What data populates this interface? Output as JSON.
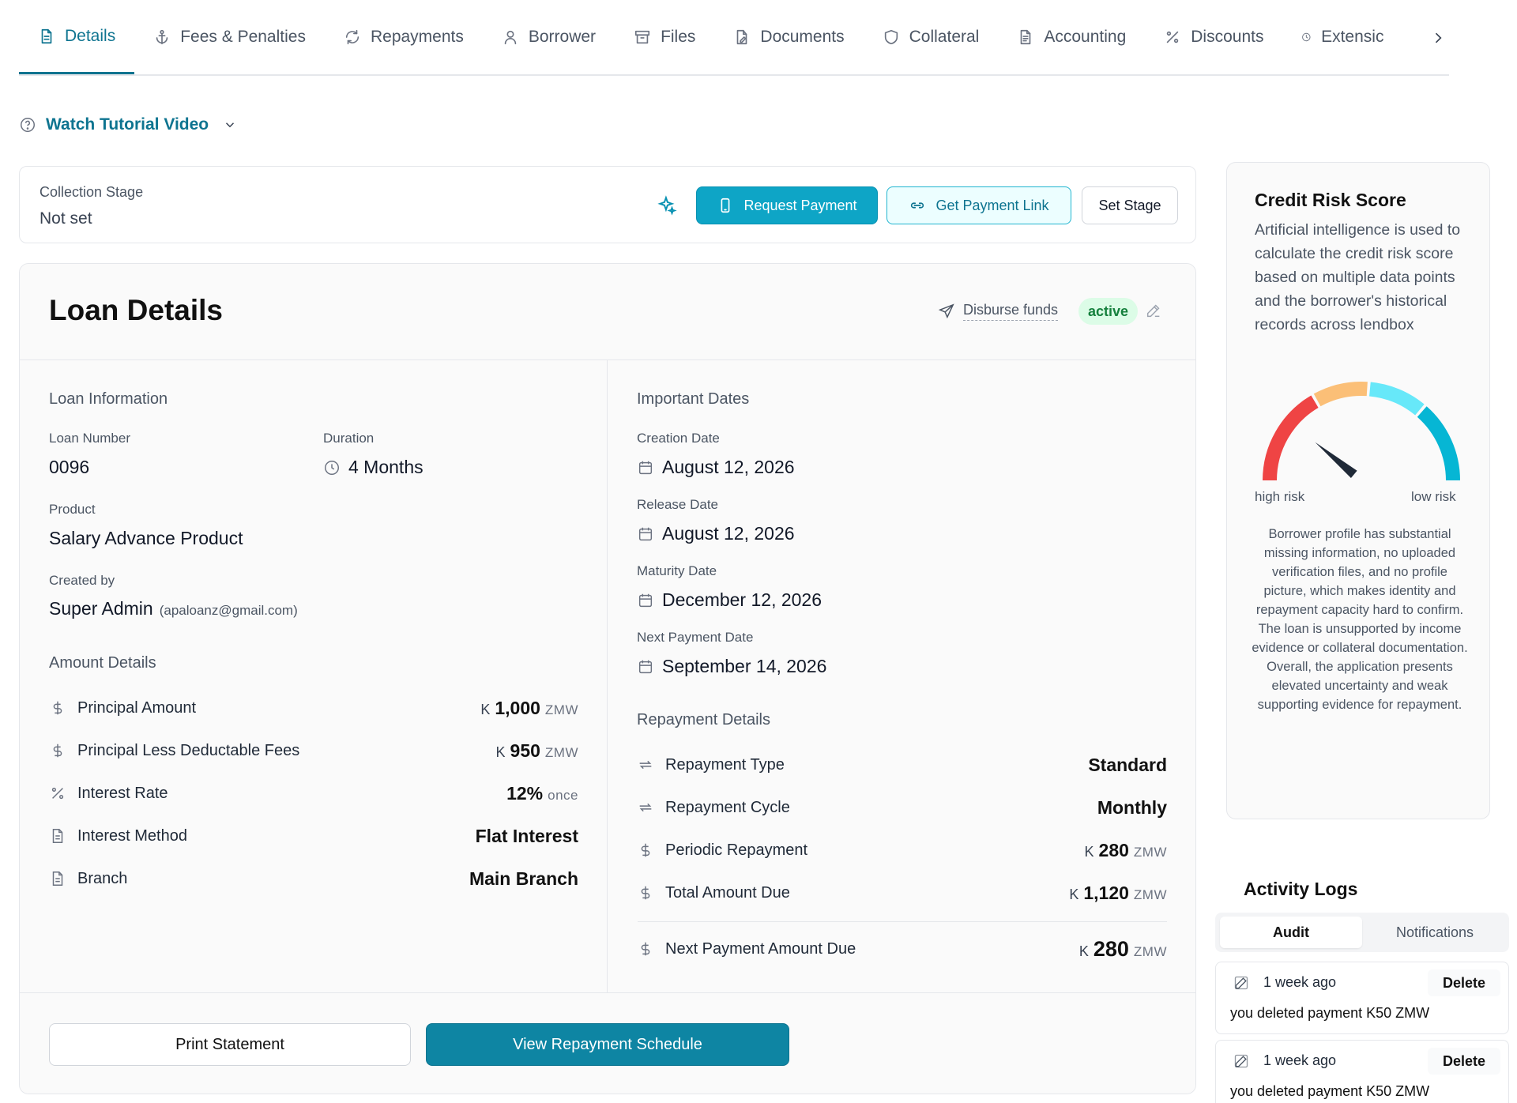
{
  "tabs": [
    {
      "label": "Details",
      "icon": "document-icon",
      "active": true
    },
    {
      "label": "Fees & Penalties",
      "icon": "anchor-icon"
    },
    {
      "label": "Repayments",
      "icon": "refresh-icon"
    },
    {
      "label": "Borrower",
      "icon": "user-icon"
    },
    {
      "label": "Files",
      "icon": "archive-icon"
    },
    {
      "label": "Documents",
      "icon": "document-edit-icon"
    },
    {
      "label": "Collateral",
      "icon": "shield-icon"
    },
    {
      "label": "Accounting",
      "icon": "ledger-icon"
    },
    {
      "label": "Discounts",
      "icon": "percent-icon"
    },
    {
      "label": "Extensic",
      "icon": "clock-icon"
    }
  ],
  "tutorial": {
    "label": "Watch Tutorial Video"
  },
  "collection": {
    "label": "Collection Stage",
    "value": "Not set",
    "request_payment": "Request Payment",
    "get_payment_link": "Get Payment Link",
    "set_stage": "Set Stage"
  },
  "loan": {
    "title": "Loan Details",
    "disburse": "Disburse funds",
    "status": "active",
    "info_title": "Loan Information",
    "loan_number_label": "Loan Number",
    "loan_number": "0096",
    "duration_label": "Duration",
    "duration": "4 Months",
    "product_label": "Product",
    "product": "Salary Advance Product",
    "created_by_label": "Created by",
    "created_by": "Super Admin",
    "created_by_email": "(apaloanz@gmail.com)",
    "amount_title": "Amount Details",
    "amounts": [
      {
        "label": "Principal Amount",
        "prefix": "K",
        "value": "1,000",
        "suffix": "ZMW"
      },
      {
        "label": "Principal Less Deductable Fees",
        "prefix": "K",
        "value": "950",
        "suffix": "ZMW"
      },
      {
        "label": "Interest Rate",
        "prefix": "",
        "value": "12%",
        "suffix": "once"
      },
      {
        "label": "Interest Method",
        "prefix": "",
        "value": "Flat Interest",
        "suffix": ""
      },
      {
        "label": "Branch",
        "prefix": "",
        "value": "Main Branch",
        "suffix": ""
      }
    ],
    "dates_title": "Important Dates",
    "dates": [
      {
        "label": "Creation Date",
        "value": "August 12, 2026"
      },
      {
        "label": "Release Date",
        "value": "August 12, 2026"
      },
      {
        "label": "Maturity Date",
        "value": "December 12, 2026"
      },
      {
        "label": "Next Payment Date",
        "value": "September 14, 2026"
      }
    ],
    "repayment_title": "Repayment Details",
    "repayments": [
      {
        "label": "Repayment Type",
        "prefix": "",
        "value": "Standard",
        "suffix": ""
      },
      {
        "label": "Repayment Cycle",
        "prefix": "",
        "value": "Monthly",
        "suffix": ""
      },
      {
        "label": "Periodic Repayment",
        "prefix": "K",
        "value": "280",
        "suffix": "ZMW"
      },
      {
        "label": "Total Amount Due",
        "prefix": "K",
        "value": "1,120",
        "suffix": "ZMW"
      }
    ],
    "next_due": {
      "label": "Next Payment Amount Due",
      "prefix": "K",
      "value": "280",
      "suffix": "ZMW"
    },
    "print_statement": "Print Statement",
    "view_schedule": "View Repayment Schedule"
  },
  "risk": {
    "title": "Credit Risk Score",
    "description": "Artificial intelligence is used to calculate the credit risk score based on multiple data points and the borrower's historical records across lendbox",
    "high_label": "high risk",
    "low_label": "low risk",
    "score_fraction": 0.22,
    "summary": "Borrower profile has substantial missing information, no uploaded verification files, and no profile picture, which makes identity and repayment capacity hard to confirm. The loan is unsupported by income evidence or collateral documentation. Overall, the application presents elevated uncertainty and weak supporting evidence for repayment.",
    "colors": {
      "high": "#ef4444",
      "mid": "#fbbf77",
      "low": "#67e8f9",
      "lowest": "#06b6d4"
    }
  },
  "activity": {
    "title": "Activity Logs",
    "tab_audit": "Audit",
    "tab_notifications": "Notifications",
    "logs": [
      {
        "time": "1 week ago",
        "action": "Delete",
        "message": "you deleted payment K50 ZMW"
      },
      {
        "time": "1 week ago",
        "action": "Delete",
        "message": "you deleted payment K50 ZMW"
      }
    ]
  },
  "colors": {
    "accent": "#0e7490",
    "primary_button": "#0ea5c6",
    "status_active": "#15803d"
  }
}
